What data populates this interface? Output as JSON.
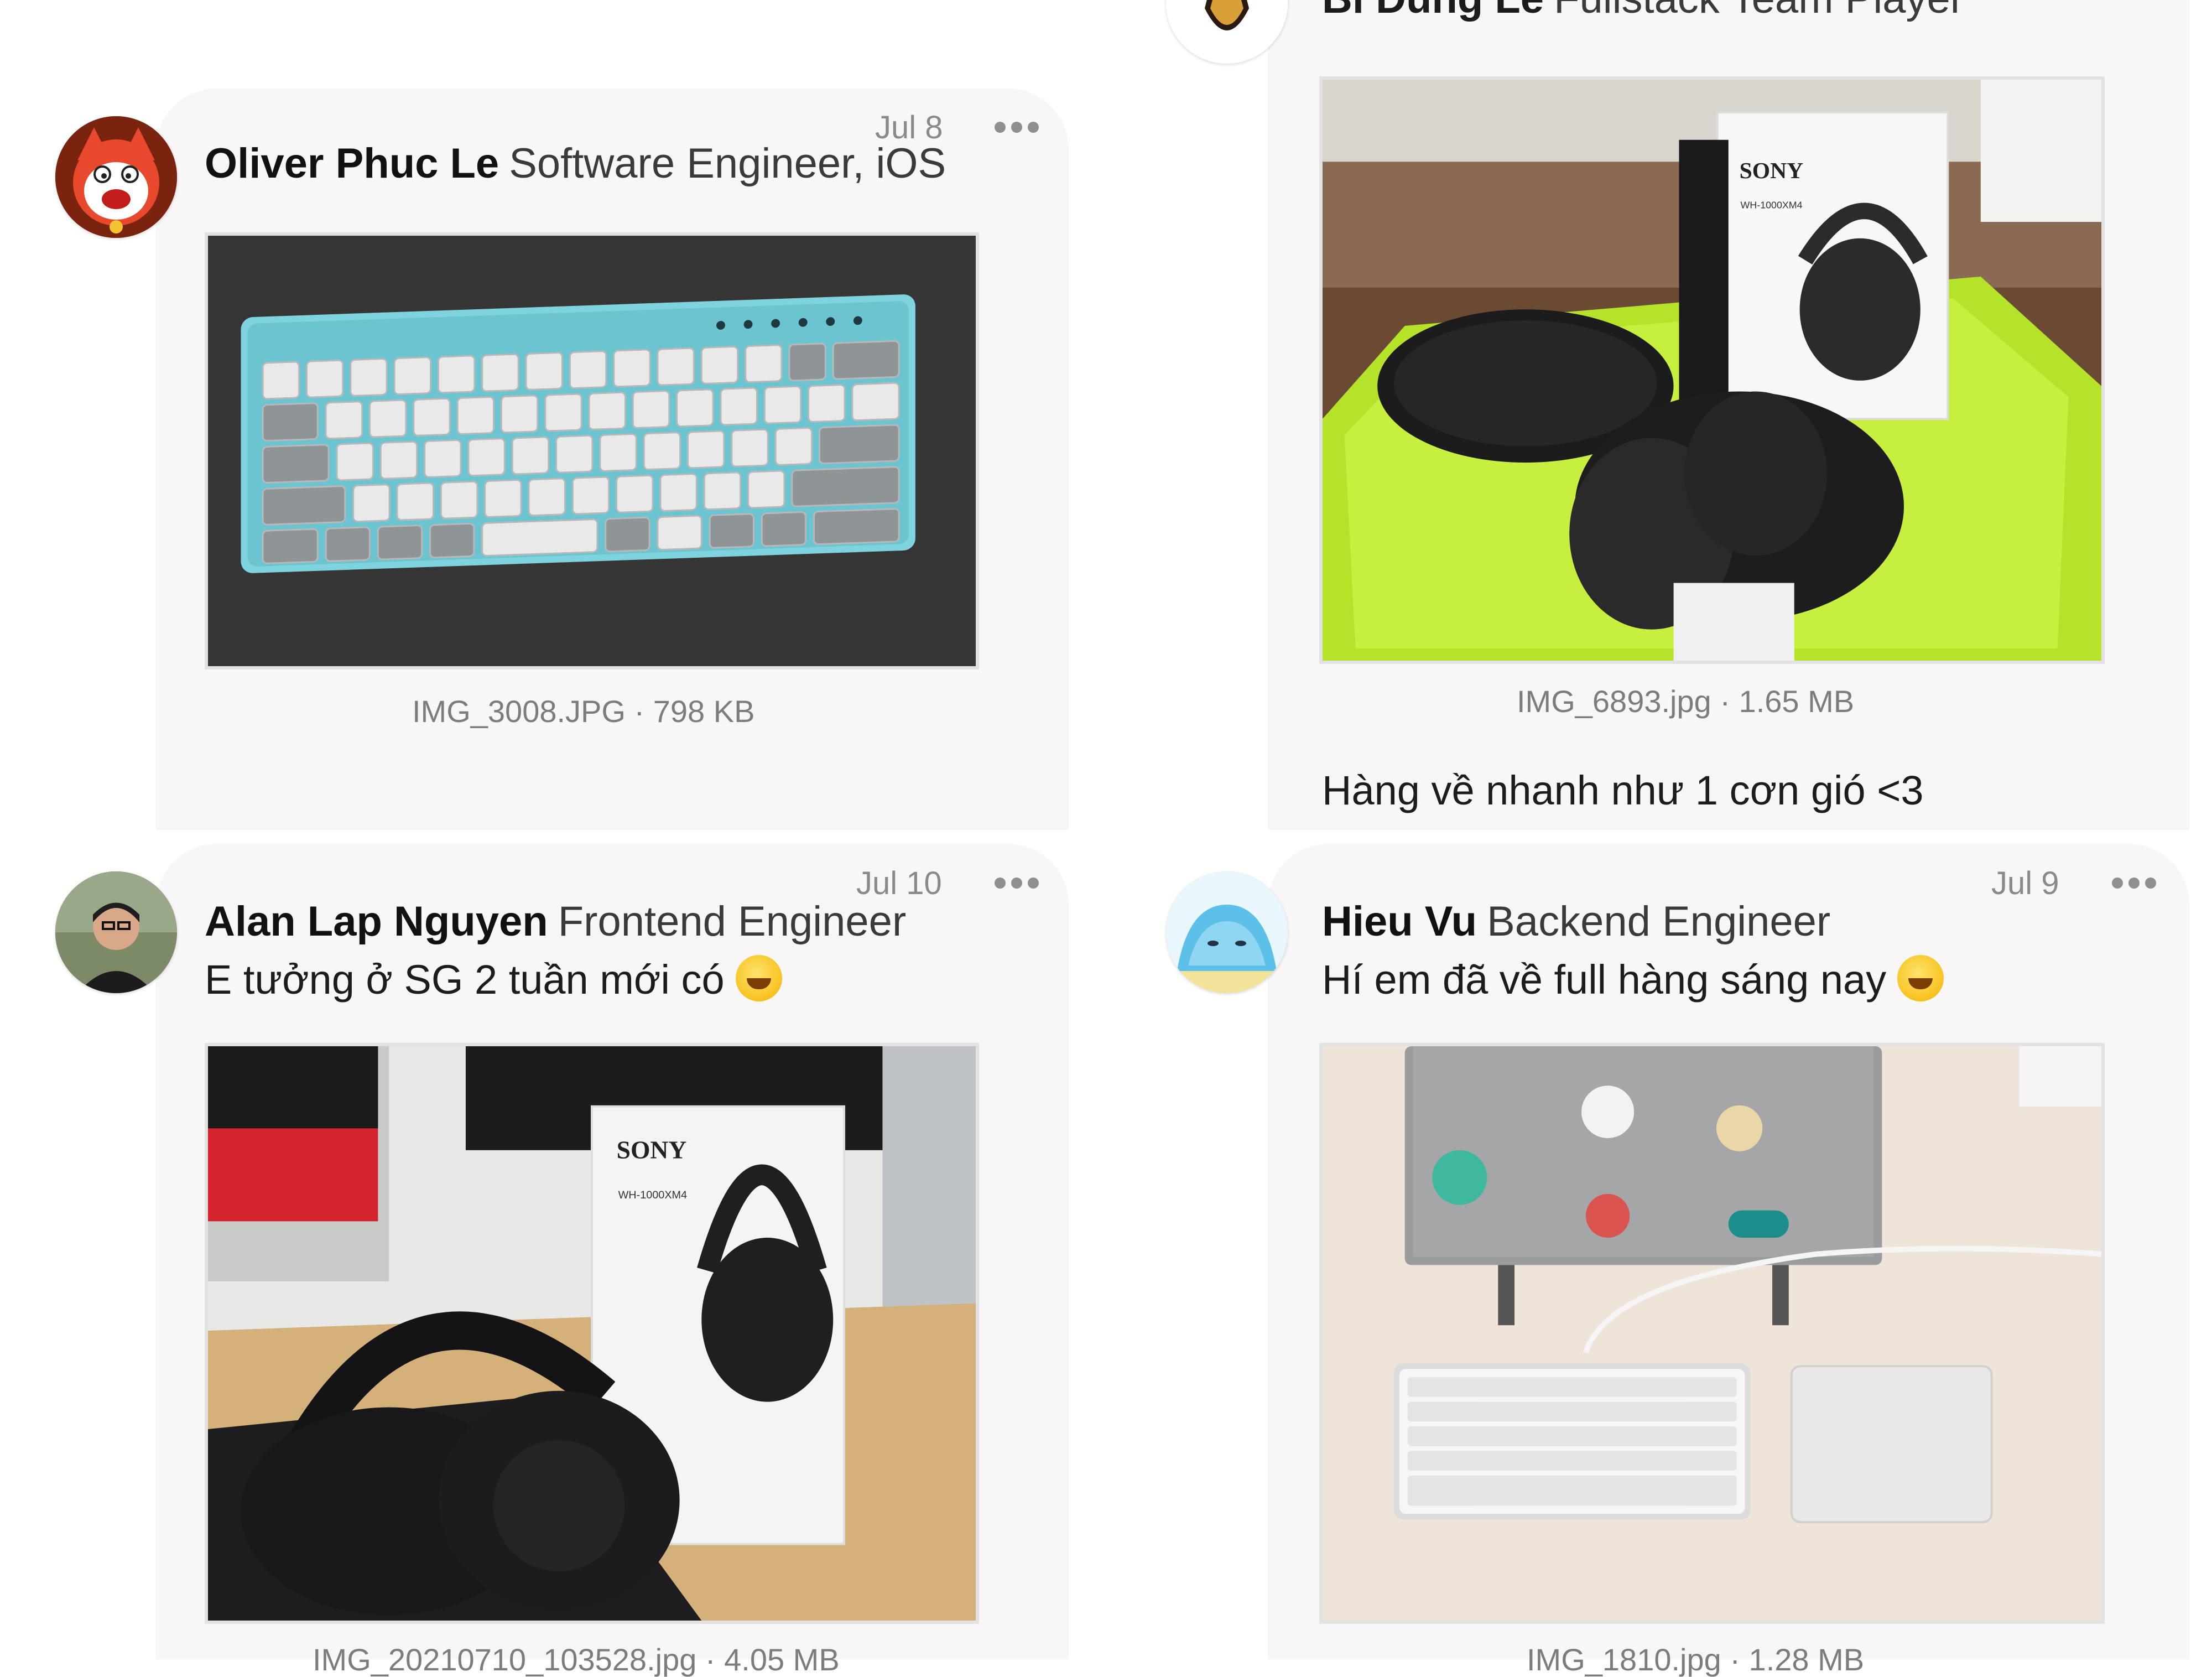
{
  "posts": [
    {
      "name": "Oliver Phuc Le",
      "role": "Software Engineer, iOS",
      "date": "Jul 8",
      "caption": "IMG_3008.JPG · 798 KB",
      "photo_subject": "keyboard-photo",
      "avatar": "cat-avatar"
    },
    {
      "name": "Bi Dung Le",
      "role": "Fullstack Team Player",
      "caption": "IMG_6893.jpg · 1.65 MB",
      "message": "Hàng về nhanh như 1 cơn gió <3",
      "photo_subject": "headphones-photo",
      "box_brand": "SONY",
      "box_model": "WH-1000XM4",
      "avatar": "logo-avatar"
    },
    {
      "name": "Alan Lap Nguyen",
      "role": "Frontend Engineer",
      "date": "Jul 10",
      "message": "E tưởng ở SG 2 tuần mới có",
      "caption": "IMG_20210710_103528.jpg · 4.05 MB",
      "photo_subject": "headphones-desk-photo",
      "box_brand": "SONY",
      "box_model": "WH-1000XM4",
      "avatar": "person-avatar"
    },
    {
      "name": "Hieu Vu",
      "role": "Backend Engineer",
      "date": "Jul 9",
      "message": "Hí em đã về full hàng sáng nay",
      "caption": "IMG_1810.jpg · 1.28 MB",
      "photo_subject": "laptop-keyboard-trackpad-photo",
      "avatar": "slime-avatar"
    }
  ],
  "icons": {
    "more": "more-icon",
    "grin_emoji": "grinning-face-emoji",
    "yum_emoji": "savoring-face-emoji"
  },
  "colors": {
    "card_bg": "#f8f6f6",
    "meta_text": "#8a8a8e",
    "keyboard_case": "#7ed3de",
    "tray_green": "#b4e32a"
  }
}
